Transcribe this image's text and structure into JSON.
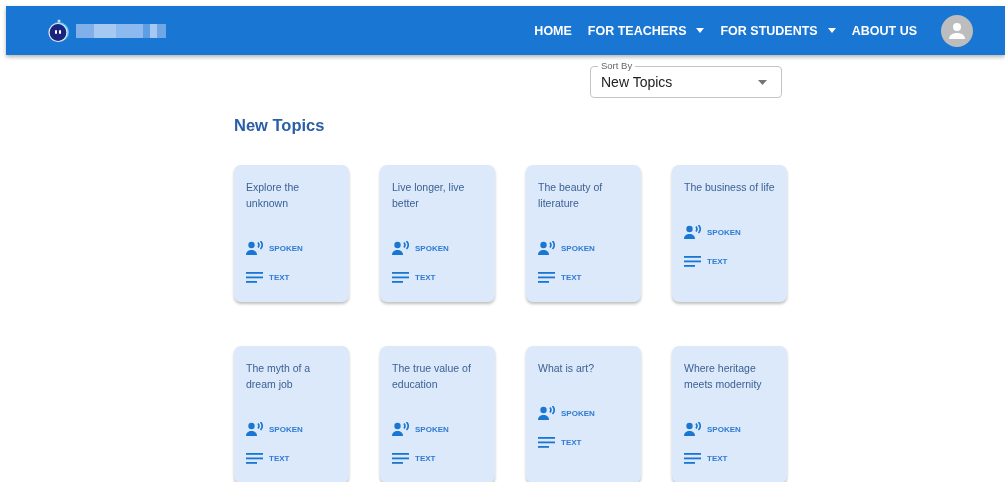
{
  "nav": {
    "links": [
      {
        "label": "HOME",
        "dropdown": false
      },
      {
        "label": "FOR TEACHERS",
        "dropdown": true
      },
      {
        "label": "FOR STUDENTS",
        "dropdown": true
      },
      {
        "label": "ABOUT US",
        "dropdown": false
      }
    ]
  },
  "sort": {
    "label": "Sort By",
    "value": "New Topics"
  },
  "heading": "New Topics",
  "topics": [
    {
      "title": "Explore the unknown",
      "modes": [
        "SPOKEN",
        "TEXT"
      ]
    },
    {
      "title": "Live longer, live better",
      "modes": [
        "SPOKEN",
        "TEXT"
      ]
    },
    {
      "title": "The beauty of literature",
      "modes": [
        "SPOKEN",
        "TEXT"
      ]
    },
    {
      "title": "The business of life",
      "modes": [
        "SPOKEN",
        "TEXT"
      ]
    },
    {
      "title": "The myth of a dream job",
      "modes": [
        "SPOKEN",
        "TEXT"
      ]
    },
    {
      "title": "The true value of education",
      "modes": [
        "SPOKEN",
        "TEXT"
      ]
    },
    {
      "title": "What is art?",
      "modes": [
        "SPOKEN",
        "TEXT"
      ]
    },
    {
      "title": "Where heritage meets modernity",
      "modes": [
        "SPOKEN",
        "TEXT"
      ]
    }
  ]
}
